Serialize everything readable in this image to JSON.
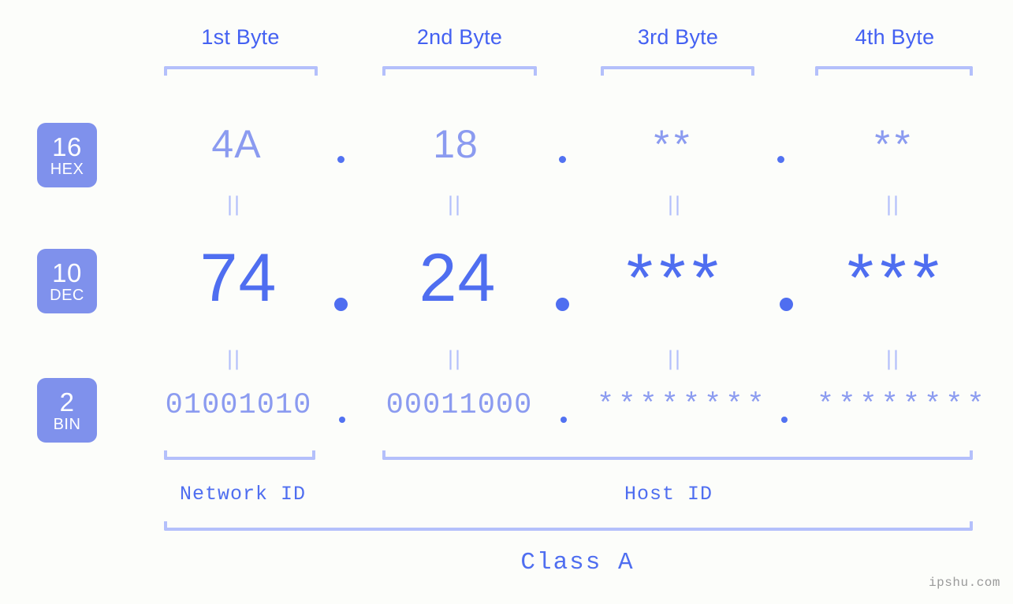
{
  "meta": {
    "background_color": "#fcfdfa",
    "accent_strong": "#4f6ef0",
    "accent_light": "#8b9bf0",
    "accent_bracket": "#b4c0fb",
    "badge_fill": "#7f91ec",
    "title_color": "#4461f2"
  },
  "headers": [
    {
      "label": "1st Byte"
    },
    {
      "label": "2nd Byte"
    },
    {
      "label": "3rd Byte"
    },
    {
      "label": "4th Byte"
    }
  ],
  "badges": [
    {
      "base": "16",
      "name": "HEX"
    },
    {
      "base": "10",
      "name": "DEC"
    },
    {
      "base": "2",
      "name": "BIN"
    }
  ],
  "rows": {
    "hex": {
      "values": [
        "4A",
        "18",
        "**",
        "**"
      ],
      "separator": "."
    },
    "dec": {
      "values": [
        "74",
        "24",
        "***",
        "***"
      ],
      "separator": "."
    },
    "bin": {
      "values": [
        "01001010",
        "00011000",
        "********",
        "********"
      ],
      "separator": "."
    }
  },
  "equals_marks": [
    "||",
    "||",
    "||",
    "||",
    "||",
    "||",
    "||",
    "||"
  ],
  "segments": [
    {
      "label": "Network ID"
    },
    {
      "label": "Host ID"
    }
  ],
  "class": {
    "label": "Class A"
  },
  "watermark": {
    "text": "ipshu.com"
  }
}
